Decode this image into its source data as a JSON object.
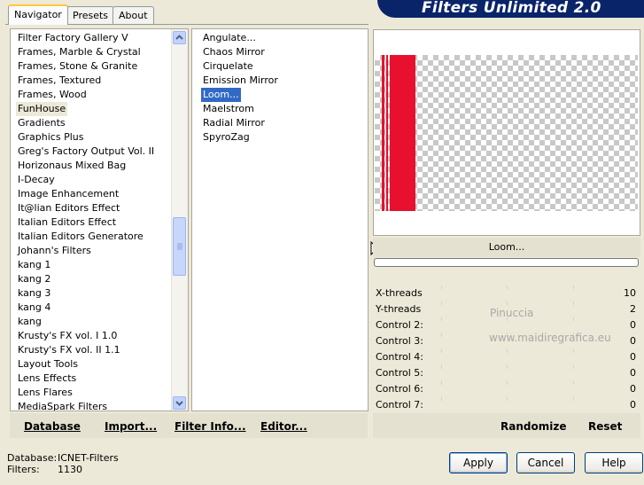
{
  "title": "Filters Unlimited 2.0",
  "tabs": [
    "Navigator",
    "Presets",
    "About"
  ],
  "categories": [
    "Filter Factory Gallery V",
    "Frames, Marble & Crystal",
    "Frames, Stone & Granite",
    "Frames, Textured",
    "Frames, Wood",
    "FunHouse",
    "Gradients",
    "Graphics Plus",
    "Greg's Factory Output Vol. II",
    "Horizonaus Mixed Bag",
    "I-Decay",
    "Image Enhancement",
    "It@lian Editors Effect",
    "Italian Editors Effect",
    "Italian Editors Generatore",
    "Johann's Filters",
    "kang 1",
    "kang 2",
    "kang 3",
    "kang 4",
    "kang",
    "Krusty's FX vol. I 1.0",
    "Krusty's FX vol. II 1.1",
    "Layout Tools",
    "Lens Effects",
    "Lens Flares",
    "MediaSpark Filters"
  ],
  "selected_category": "FunHouse",
  "filters": [
    "Angulate...",
    "Chaos Mirror",
    "Cirquelate",
    "Emission Mirror",
    "Loom...",
    "Maelstrom",
    "Radial Mirror",
    "SpyroZag"
  ],
  "selected_filter": "Loom...",
  "filter_label": "Loom...",
  "controls": [
    {
      "name": "X-threads",
      "value": "10"
    },
    {
      "name": "Y-threads",
      "value": "2"
    },
    {
      "name": "Control 2:",
      "value": "0"
    },
    {
      "name": "Control 3:",
      "value": "0"
    },
    {
      "name": "Control 4:",
      "value": "0"
    },
    {
      "name": "Control 5:",
      "value": "0"
    },
    {
      "name": "Control 6:",
      "value": "0"
    },
    {
      "name": "Control 7:",
      "value": "0"
    }
  ],
  "watermark": [
    "Pinuccia",
    "www.maidiregrafica.eu"
  ],
  "bottom_links": {
    "database": "Database",
    "import": "Import...",
    "filter_info": "Filter Info...",
    "editor": "Editor...",
    "randomize": "Randomize",
    "reset": "Reset"
  },
  "status": {
    "database_label": "Database:",
    "database_value": "ICNET-Filters",
    "filters_label": "Filters:",
    "filters_value": "1130"
  },
  "buttons": {
    "apply": "Apply",
    "cancel": "Cancel",
    "help": "Help"
  },
  "colors": {
    "accent": "#316AC5",
    "banner": "#0A246A",
    "preview_stripe": "#E8102E"
  }
}
